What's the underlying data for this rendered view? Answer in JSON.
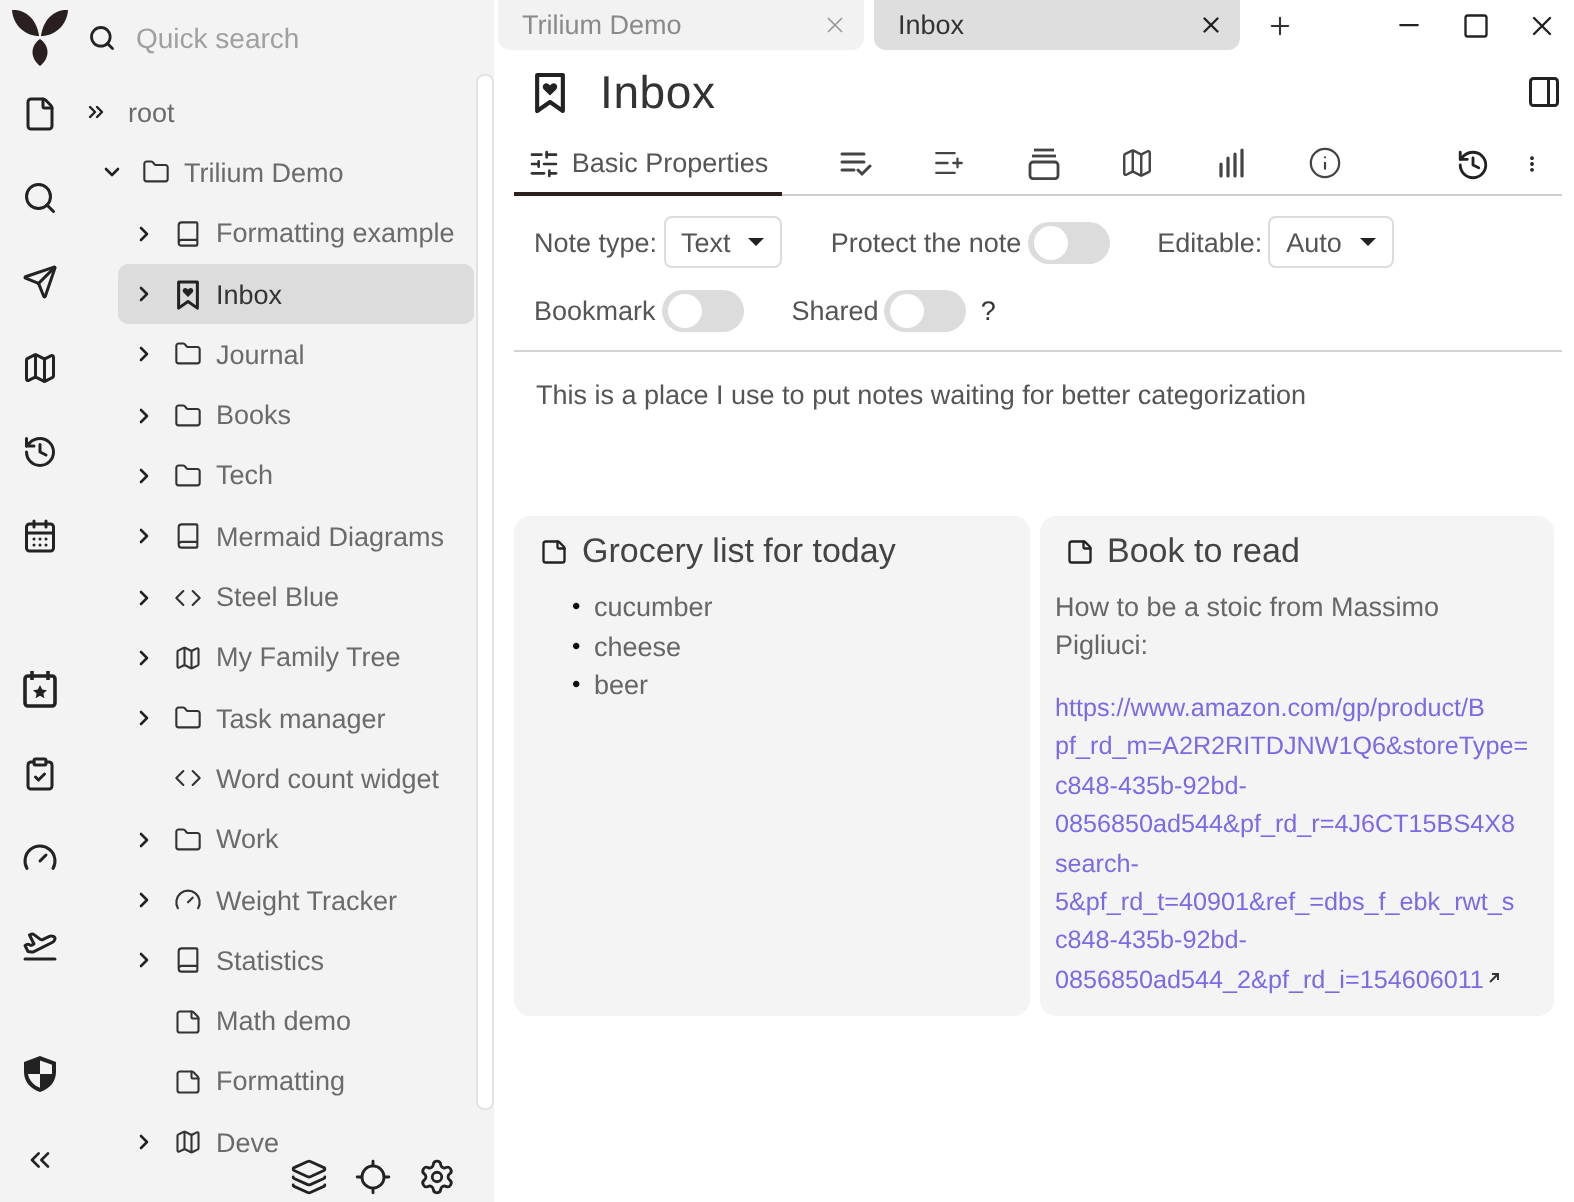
{
  "search": {
    "placeholder": "Quick search"
  },
  "tree": {
    "items": [
      {
        "kind": "root",
        "title": "root",
        "selected": false,
        "children": [
          {
            "kind": "folder",
            "title": "Trilium Demo",
            "expandable": true,
            "expanded": true,
            "selected": false,
            "children": [
              {
                "kind": "book",
                "title": "Formatting example",
                "expandable": true,
                "expanded": false,
                "selected": false
              },
              {
                "kind": "bookmark",
                "title": "Inbox",
                "expandable": true,
                "expanded": false,
                "selected": true
              },
              {
                "kind": "folder",
                "title": "Journal",
                "expandable": true,
                "expanded": false,
                "selected": false
              },
              {
                "kind": "folder",
                "title": "Books",
                "expandable": true,
                "expanded": false,
                "selected": false
              },
              {
                "kind": "folder",
                "title": "Tech",
                "expandable": true,
                "expanded": false,
                "selected": false
              },
              {
                "kind": "book",
                "title": "Mermaid Diagrams",
                "expandable": true,
                "expanded": false,
                "selected": false
              },
              {
                "kind": "code",
                "title": "Steel Blue",
                "expandable": true,
                "expanded": false,
                "selected": false
              },
              {
                "kind": "map",
                "title": "My Family Tree",
                "expandable": true,
                "expanded": false,
                "selected": false
              },
              {
                "kind": "folder",
                "title": "Task manager",
                "expandable": true,
                "expanded": false,
                "selected": false
              },
              {
                "kind": "code",
                "title": "Word count widget",
                "expandable": false,
                "expanded": false,
                "selected": false
              },
              {
                "kind": "folder",
                "title": "Work",
                "expandable": true,
                "expanded": false,
                "selected": false
              },
              {
                "kind": "gauge",
                "title": "Weight Tracker",
                "expandable": true,
                "expanded": false,
                "selected": false
              },
              {
                "kind": "book",
                "title": "Statistics",
                "expandable": true,
                "expanded": false,
                "selected": false
              },
              {
                "kind": "note",
                "title": "Math demo",
                "expandable": false,
                "expanded": false,
                "selected": false
              },
              {
                "kind": "note",
                "title": "Formatting",
                "expandable": false,
                "expanded": false,
                "selected": false
              },
              {
                "kind": "map",
                "title": "Deve",
                "expandable": true,
                "expanded": false,
                "selected": false
              }
            ]
          }
        ]
      }
    ]
  },
  "tabs": [
    {
      "label": "Trilium Demo",
      "selected": false
    },
    {
      "label": "Inbox",
      "selected": true
    }
  ],
  "note": {
    "title": "Inbox"
  },
  "ribbon": {
    "tabs": [
      {
        "label": "Basic Properties",
        "selected": true
      },
      {
        "selected": false
      },
      {
        "selected": false
      },
      {
        "selected": false
      },
      {
        "selected": false
      },
      {
        "selected": false
      },
      {
        "selected": false
      }
    ]
  },
  "properties": {
    "note_type": {
      "label": "Note type:",
      "value": "Text"
    },
    "protect": {
      "label": "Protect the note",
      "on": false
    },
    "editable": {
      "label": "Editable:",
      "value": "Auto"
    },
    "bookmark": {
      "label": "Bookmark",
      "on": false
    },
    "shared": {
      "label": "Shared",
      "on": false,
      "help": "?"
    }
  },
  "content": {
    "text": "This is a place I use to put notes waiting for better categorization"
  },
  "cards": [
    {
      "kind": "list",
      "title": "Grocery list for today",
      "items": [
        {
          "marker": "•",
          "text": "cucumber"
        },
        {
          "marker": "•",
          "text": "cheese"
        },
        {
          "marker": "•",
          "text": "beer"
        }
      ]
    },
    {
      "kind": "text",
      "title": "Book to read",
      "text": "How to be a stoic from Massimo Pigliuci:",
      "link_lines": [
        "https://www.amazon.com/gp/product/B",
        "pf_rd_m=A2R2RITDJNW1Q6&storeType=",
        "c848-435b-92bd-",
        "0856850ad544&pf_rd_r=4J6CT15BS4X8",
        "search-",
        "5&pf_rd_t=40901&ref_=dbs_f_ebk_rwt_s",
        "c848-435b-92bd-",
        "0856850ad544_2&pf_rd_i=154606011"
      ]
    }
  ]
}
